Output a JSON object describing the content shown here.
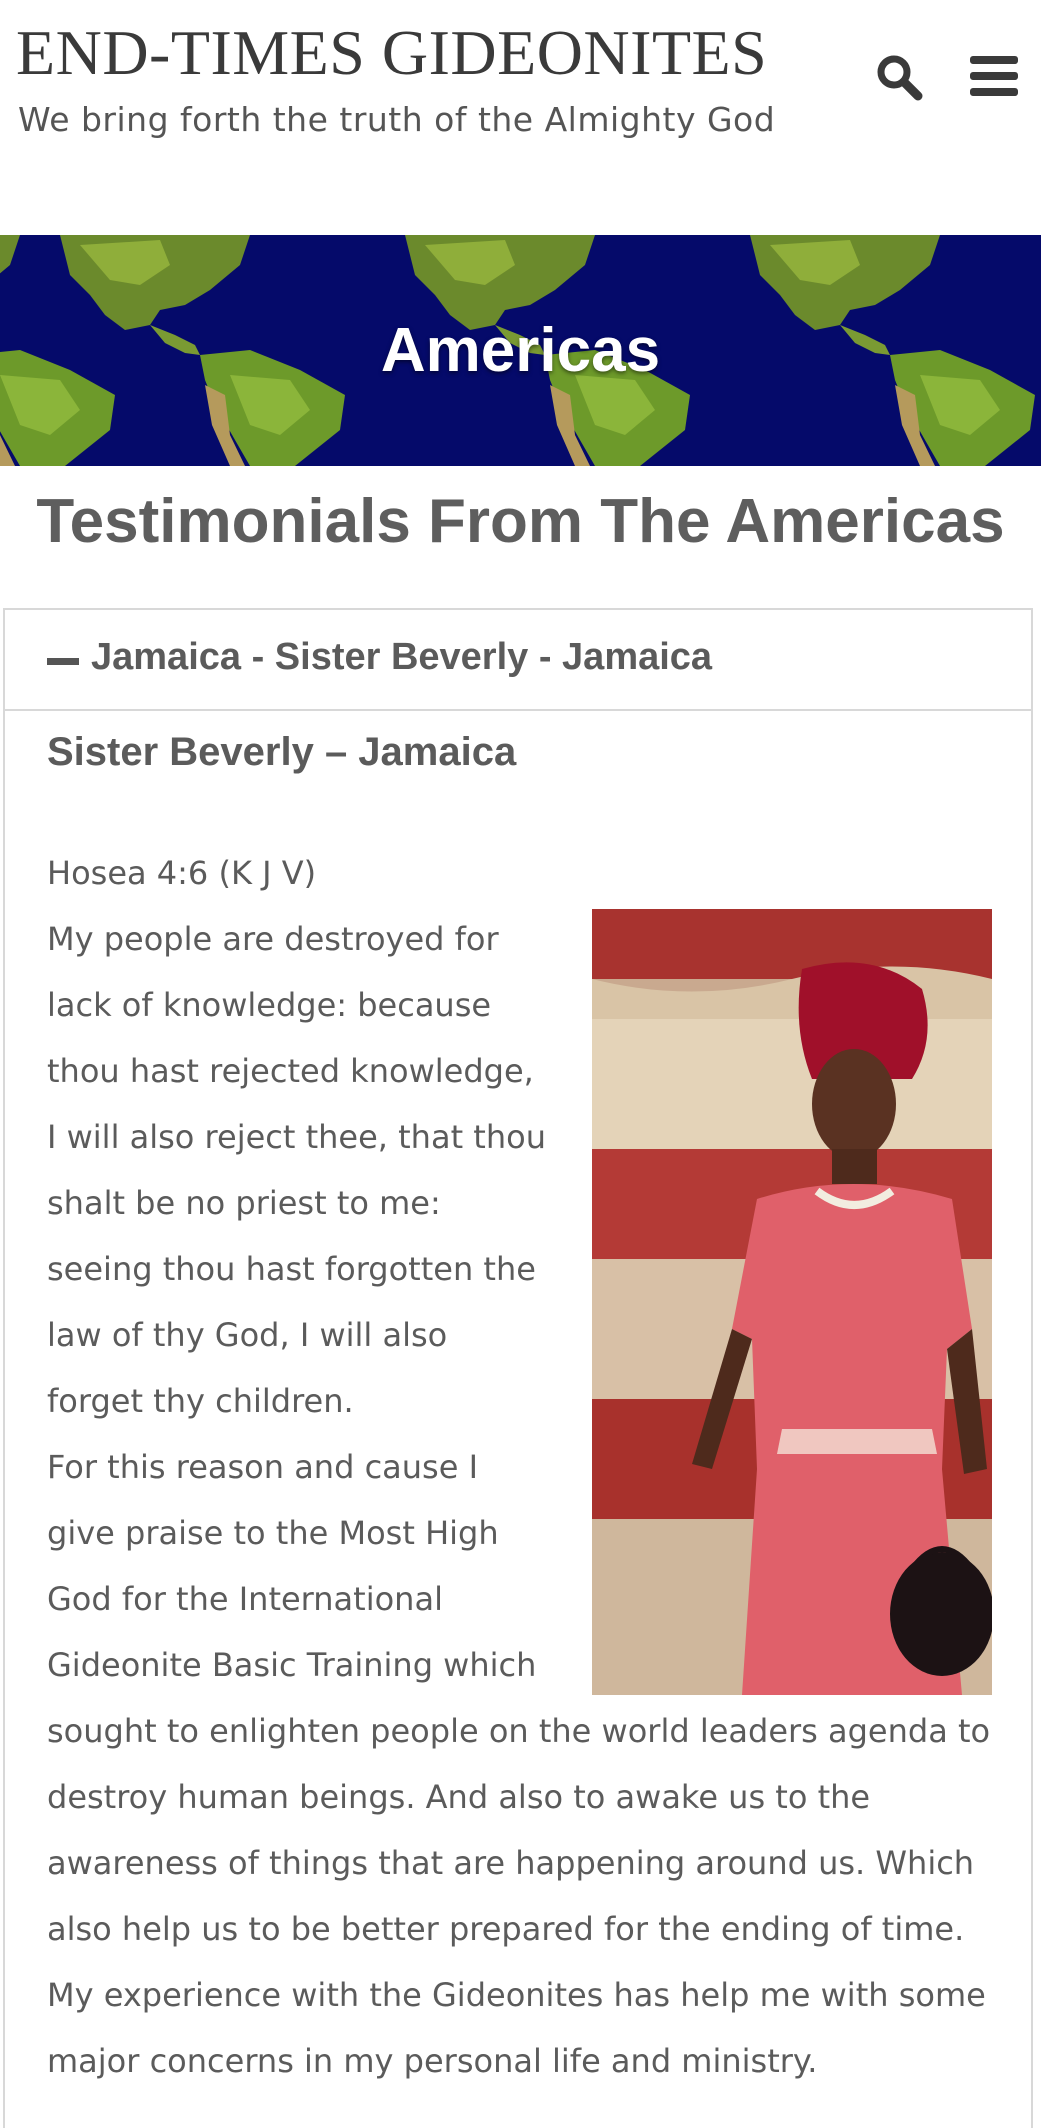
{
  "site": {
    "title": "END-TIMES GIDEONITES",
    "tagline": "We bring forth the truth of the Almighty God"
  },
  "header_icons": [
    "search-icon",
    "menu-icon"
  ],
  "banner": {
    "title": "Americas"
  },
  "page": {
    "heading": "Testimonials From The Americas"
  },
  "accordion": {
    "header": "Jamaica - Sister Beverly - Jamaica",
    "expanded": true,
    "post_title": "Sister Beverly – Jamaica",
    "scripture_ref": "Hosea 4:6 (K J V)",
    "body_lines": [
      "My people are destroyed for",
      "lack of knowledge: because",
      "thou hast rejected knowledge,",
      "I will also reject thee, that thou",
      "shalt be no priest to me:",
      "seeing thou hast forgotten the",
      "law of thy God, I will also",
      "forget thy children.",
      "For this reason and cause I",
      "give praise to the Most High",
      "God for the International",
      "Gideonite Basic Training which",
      "sought to enlighten people on the world leaders agenda to",
      "destroy human beings. And also to awake us to the",
      "awareness of things that are happening around us. Which",
      "also help us to be better prepared for the ending of time.",
      "My experience with the Gideonites has help me with some",
      "major concerns in my personal life and ministry."
    ]
  },
  "colors": {
    "banner_bg": "#050a6a",
    "text": "#5b5b5b",
    "border": "#d8d8d8"
  }
}
